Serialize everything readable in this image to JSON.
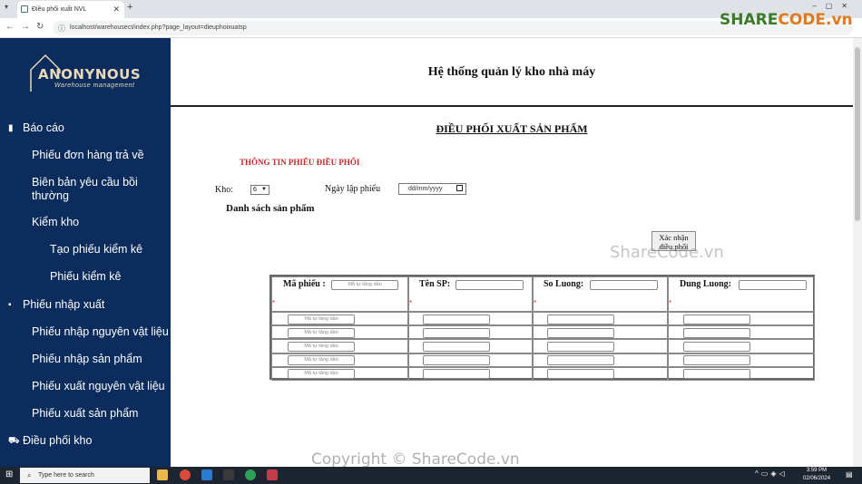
{
  "browser": {
    "tab_title": "Điều phối xuất NVL",
    "url": "localhost/warehousect/index.php?page_layout=dieuphoixuatsp"
  },
  "sidebar": {
    "logo_word": "ANONYNOUS",
    "logo_tag": "Warehouse management",
    "items": [
      {
        "label": "Báo cáo",
        "icon": "bar-chart-icon"
      },
      {
        "label": "Phiếu đơn hàng trả về"
      },
      {
        "label": "Biên bản yêu cầu bồi thường"
      },
      {
        "label": "Kiểm kho"
      },
      {
        "label": "Tạo phiếu kiểm kê"
      },
      {
        "label": "Phiếu kiểm kê"
      },
      {
        "label": "Phiếu nhập xuất",
        "icon": "clipboard-icon"
      },
      {
        "label": "Phiếu nhập nguyên vật liệu"
      },
      {
        "label": "Phiếu nhập sản phẩm"
      },
      {
        "label": "Phiếu xuất nguyên vật liệu"
      },
      {
        "label": "Phiếu xuất sản phẩm"
      },
      {
        "label": "Điều phối kho",
        "icon": "truck-icon"
      }
    ]
  },
  "header": {
    "title": "Hệ thống quản lý kho nhà máy"
  },
  "form": {
    "title": "ĐIỀU PHỐI XUẤT SẢN PHẨM",
    "section_heading": "THÔNG TIN PHIẾU ĐIỀU PHỐI",
    "kho_label": "Kho:",
    "kho_value": "6",
    "date_label": "Ngày lập phiếu",
    "date_placeholder": "dd/mm/yyyy",
    "list_heading": "Danh sách sản phẩm",
    "confirm_button": "Xác nhận điều phối"
  },
  "table": {
    "columns": [
      "Mã phiếu :",
      "Tên SP:",
      "So Luong:",
      "Dung Luong:"
    ],
    "header_input_placeholder": "Mã tự tăng dần",
    "required_mark": "*",
    "rows": [
      {
        "ma_phieu": "Mã tự tăng dần"
      },
      {
        "ma_phieu": "Mã tự tăng dần"
      },
      {
        "ma_phieu": "Mã tự tăng dần"
      },
      {
        "ma_phieu": "Mã tự tăng dần"
      },
      {
        "ma_phieu": "Mã tự tăng dần"
      }
    ]
  },
  "watermarks": {
    "logo_pre": "SHARE",
    "logo_post": "CODE.vn",
    "mid": "ShareCode.vn",
    "bottom": "Copyright © ShareCode.vn"
  },
  "taskbar": {
    "search_placeholder": "Type here to search",
    "time": "3:59 PM",
    "date": "02/06/2024"
  }
}
